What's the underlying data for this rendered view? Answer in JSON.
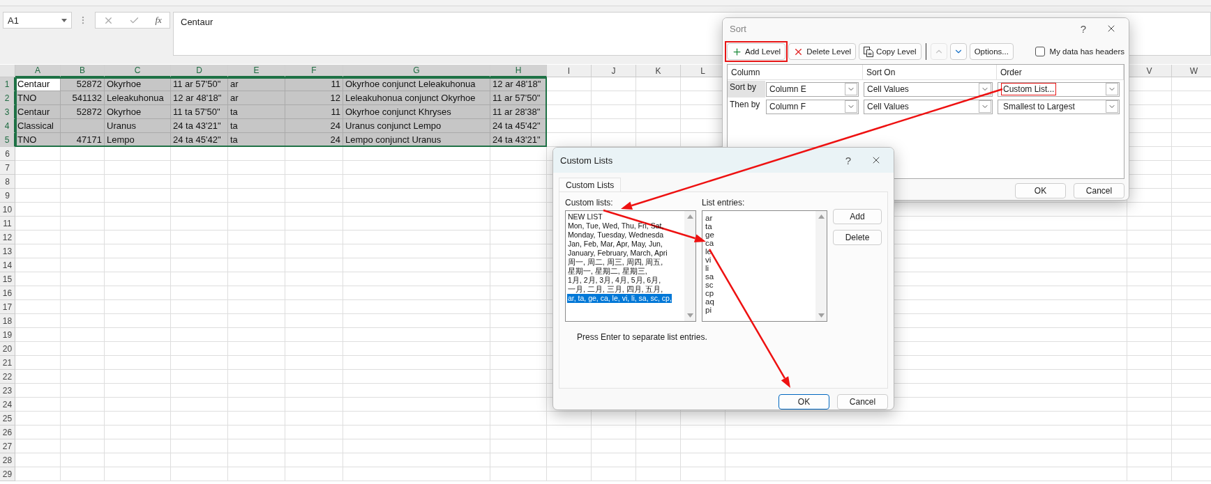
{
  "name_box": {
    "value": "A1"
  },
  "formula_bar": {
    "function_label": "fx",
    "value": "Centaur"
  },
  "sheet": {
    "columns": [
      {
        "label": "A",
        "selected": true,
        "numeric": false
      },
      {
        "label": "B",
        "selected": true,
        "numeric": true
      },
      {
        "label": "C",
        "selected": true,
        "numeric": false
      },
      {
        "label": "D",
        "selected": true,
        "numeric": false
      },
      {
        "label": "E",
        "selected": true,
        "numeric": false
      },
      {
        "label": "F",
        "selected": true,
        "numeric": true
      },
      {
        "label": "G",
        "selected": true,
        "numeric": false
      },
      {
        "label": "H",
        "selected": true,
        "numeric": false
      },
      {
        "label": "I",
        "selected": false,
        "numeric": false
      },
      {
        "label": "J",
        "selected": false,
        "numeric": false
      },
      {
        "label": "K",
        "selected": false,
        "numeric": false
      },
      {
        "label": "L",
        "selected": false,
        "numeric": false
      }
    ],
    "columns_right": [
      {
        "label": "V",
        "selected": false
      },
      {
        "label": "W",
        "selected": false
      }
    ],
    "rows": [
      {
        "number": "1",
        "selected": true,
        "cells": [
          {
            "text": "Centaur",
            "active": true
          },
          {
            "text": "52872",
            "active": false
          },
          {
            "text": "Okyrhoe",
            "active": false
          },
          {
            "text": "11 ar 57'50\"",
            "active": false
          },
          {
            "text": "ar",
            "active": false
          },
          {
            "text": "11",
            "active": false
          },
          {
            "text": "Okyrhoe conjunct Leleakuhonua",
            "active": false
          },
          {
            "text": "12 ar 48'18\"",
            "active": false
          }
        ]
      },
      {
        "number": "2",
        "selected": true,
        "cells": [
          {
            "text": "TNO",
            "active": false
          },
          {
            "text": "541132",
            "active": false
          },
          {
            "text": "Leleakuhonua",
            "active": false
          },
          {
            "text": "12 ar 48'18\"",
            "active": false
          },
          {
            "text": "ar",
            "active": false
          },
          {
            "text": "12",
            "active": false
          },
          {
            "text": "Leleakuhonua conjunct Okyrhoe",
            "active": false
          },
          {
            "text": "11 ar 57'50\"",
            "active": false
          }
        ]
      },
      {
        "number": "3",
        "selected": true,
        "cells": [
          {
            "text": "Centaur",
            "active": false
          },
          {
            "text": "52872",
            "active": false
          },
          {
            "text": "Okyrhoe",
            "active": false
          },
          {
            "text": "11 ta 57'50\"",
            "active": false
          },
          {
            "text": "ta",
            "active": false
          },
          {
            "text": "11",
            "active": false
          },
          {
            "text": "Okyrhoe conjunct Khryses",
            "active": false
          },
          {
            "text": "11 ar 28'38\"",
            "active": false
          }
        ]
      },
      {
        "number": "4",
        "selected": true,
        "cells": [
          {
            "text": "Classical",
            "active": false
          },
          {
            "active": false
          },
          {
            "text": "Uranus",
            "active": false
          },
          {
            "text": "24 ta 43'21\"",
            "active": false
          },
          {
            "text": "ta",
            "active": false
          },
          {
            "text": "24",
            "active": false
          },
          {
            "text": "Uranus conjunct Lempo",
            "active": false
          },
          {
            "text": "24 ta 45'42\"",
            "active": false
          }
        ]
      },
      {
        "number": "5",
        "selected": true,
        "cells": [
          {
            "text": "TNO",
            "active": false
          },
          {
            "text": "47171",
            "active": false
          },
          {
            "text": "Lempo",
            "active": false
          },
          {
            "text": "24 ta 45'42\"",
            "active": false
          },
          {
            "text": "ta",
            "active": false
          },
          {
            "text": "24",
            "active": false
          },
          {
            "text": "Lempo conjunct Uranus",
            "active": false
          },
          {
            "text": "24 ta 43'21\"",
            "active": false
          }
        ]
      },
      {
        "number": "6",
        "selected": false,
        "cells": []
      },
      {
        "number": "7",
        "selected": false,
        "cells": []
      },
      {
        "number": "8",
        "selected": false,
        "cells": []
      },
      {
        "number": "9",
        "selected": false,
        "cells": []
      },
      {
        "number": "10",
        "selected": false,
        "cells": []
      },
      {
        "number": "11",
        "selected": false,
        "cells": []
      },
      {
        "number": "12",
        "selected": false,
        "cells": []
      },
      {
        "number": "13",
        "selected": false,
        "cells": []
      },
      {
        "number": "14",
        "selected": false,
        "cells": []
      },
      {
        "number": "15",
        "selected": false,
        "cells": []
      },
      {
        "number": "16",
        "selected": false,
        "cells": []
      },
      {
        "number": "17",
        "selected": false,
        "cells": []
      },
      {
        "number": "18",
        "selected": false,
        "cells": []
      },
      {
        "number": "19",
        "selected": false,
        "cells": []
      },
      {
        "number": "20",
        "selected": false,
        "cells": []
      },
      {
        "number": "21",
        "selected": false,
        "cells": []
      },
      {
        "number": "22",
        "selected": false,
        "cells": []
      },
      {
        "number": "23",
        "selected": false,
        "cells": []
      },
      {
        "number": "24",
        "selected": false,
        "cells": []
      },
      {
        "number": "25",
        "selected": false,
        "cells": []
      },
      {
        "number": "26",
        "selected": false,
        "cells": []
      },
      {
        "number": "27",
        "selected": false,
        "cells": []
      },
      {
        "number": "28",
        "selected": false,
        "cells": []
      },
      {
        "number": "29",
        "selected": false,
        "cells": []
      }
    ]
  },
  "sort_dialog": {
    "title": "Sort",
    "help": "?",
    "toolbar": [
      {
        "kind": "add",
        "label": "Add Level",
        "disabled": false,
        "highlighted": true
      },
      {
        "kind": "delete",
        "label": "Delete Level",
        "disabled": false,
        "highlighted": false
      },
      {
        "kind": "copy",
        "label": "Copy Level",
        "disabled": false,
        "highlighted": false
      },
      {
        "kind": "up",
        "disabled": true,
        "highlighted": false
      },
      {
        "kind": "down",
        "disabled": false,
        "highlighted": false
      },
      {
        "kind": "options",
        "label": "Options...",
        "disabled": false,
        "highlighted": false
      }
    ],
    "headers_checkbox": {
      "label": "My data has headers",
      "checked": false
    },
    "columns": [
      "Column",
      "Sort On",
      "Order"
    ],
    "levels": [
      {
        "label": "Sort by",
        "column": "Column E",
        "sort_on": "Cell Values",
        "order": "Custom List...",
        "order_highlighted": true,
        "selected": true
      },
      {
        "label": "Then by",
        "column": "Column F",
        "sort_on": "Cell Values",
        "order": "Smallest to Largest",
        "order_highlighted": false,
        "selected": false
      }
    ],
    "buttons": [
      {
        "label": "OK",
        "default": false
      },
      {
        "label": "Cancel",
        "default": false
      }
    ]
  },
  "custom_lists_dialog": {
    "title": "Custom Lists",
    "help": "?",
    "tabs": [
      {
        "label": "Custom Lists",
        "selected": true
      }
    ],
    "lists_label": "Custom lists:",
    "lists": [
      {
        "text": "NEW LIST",
        "selected": false
      },
      {
        "text": "Mon, Tue, Wed, Thu, Fri, Sat,",
        "selected": false
      },
      {
        "text": "Monday, Tuesday, Wednesda",
        "selected": false
      },
      {
        "text": "Jan, Feb, Mar, Apr, May, Jun,",
        "selected": false
      },
      {
        "text": "January, February, March, Apri",
        "selected": false
      },
      {
        "text": "周一, 周二, 周三, 周四, 周五,",
        "selected": false
      },
      {
        "text": "星期一, 星期二, 星期三,",
        "selected": false
      },
      {
        "text": "1月, 2月, 3月, 4月, 5月, 6月,",
        "selected": false
      },
      {
        "text": "一月, 二月, 三月, 四月, 五月,",
        "selected": false
      },
      {
        "text": "ar, ta, ge, ca, le, vi, li, sa, sc, cp,",
        "selected": true
      }
    ],
    "entries_label": "List entries:",
    "entries": [
      "ar",
      "ta",
      "ge",
      "ca",
      "le",
      "vi",
      "li",
      "sa",
      "sc",
      "cp",
      "aq",
      "pi"
    ],
    "side_buttons": [
      "Add",
      "Delete"
    ],
    "hint": "Press Enter to separate list entries.",
    "buttons": [
      {
        "label": "OK",
        "default": true
      },
      {
        "label": "Cancel",
        "default": false
      }
    ]
  }
}
